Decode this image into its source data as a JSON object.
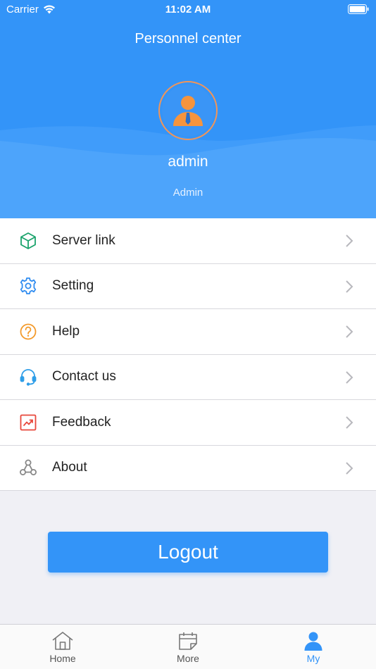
{
  "status_bar": {
    "carrier": "Carrier",
    "time": "11:02 AM"
  },
  "header": {
    "title": "Personnel center"
  },
  "user": {
    "name": "admin",
    "role": "Admin"
  },
  "menu": {
    "items": [
      {
        "label": "Server link",
        "icon": "cube-icon",
        "color": "#1aa36b"
      },
      {
        "label": "Setting",
        "icon": "gear-icon",
        "color": "#2f8cf0"
      },
      {
        "label": "Help",
        "icon": "question-icon",
        "color": "#f39a2b"
      },
      {
        "label": "Contact us",
        "icon": "headset-icon",
        "color": "#2f9ee8"
      },
      {
        "label": "Feedback",
        "icon": "trend-chart-icon",
        "color": "#e8483c"
      },
      {
        "label": "About",
        "icon": "nodes-icon",
        "color": "#888888"
      }
    ]
  },
  "logout_label": "Logout",
  "tabs": [
    {
      "label": "Home",
      "icon": "home-icon",
      "active": false
    },
    {
      "label": "More",
      "icon": "calendar-icon",
      "active": false
    },
    {
      "label": "My",
      "icon": "person-icon",
      "active": true
    }
  ],
  "colors": {
    "accent": "#3394f8",
    "avatar_ring": "#f0955a",
    "avatar_figure": "#f6943c"
  }
}
